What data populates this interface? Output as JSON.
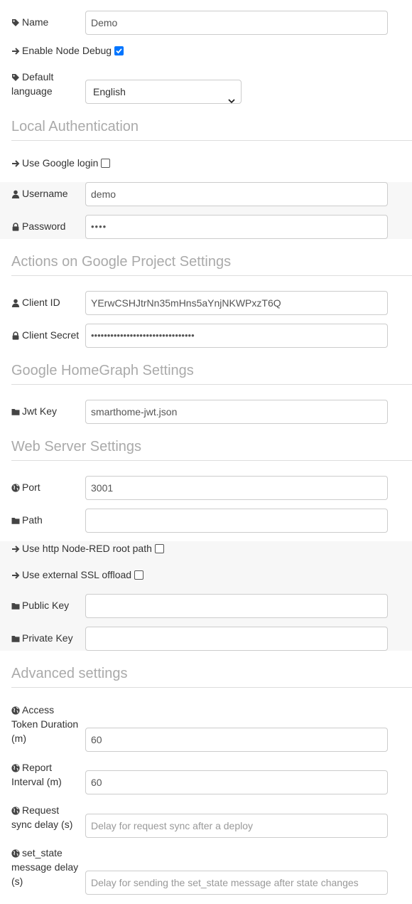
{
  "general": {
    "name_label": "Name",
    "name_value": "Demo",
    "debug_label": "Enable Node Debug",
    "debug_checked": true,
    "language_label_1": "Default",
    "language_label_2": "language",
    "language_value": "English"
  },
  "local_auth": {
    "title": "Local Authentication",
    "google_login_label": "Use Google login",
    "username_label": "Username",
    "username_value": "demo",
    "password_label": "Password",
    "password_mask": "••••"
  },
  "actions_google": {
    "title": "Actions on Google Project Settings",
    "client_id_label": "Client ID",
    "client_id_value": "YErwCSHJtrNn35mHns5aYnjNKWPxzT6Q",
    "client_secret_label": "Client Secret",
    "client_secret_mask": "••••••••••••••••••••••••••••••••"
  },
  "homegraph": {
    "title": "Google HomeGraph Settings",
    "jwt_label": "Jwt Key",
    "jwt_value": "smarthome-jwt.json"
  },
  "web_server": {
    "title": "Web Server Settings",
    "port_label": "Port",
    "port_value": "3001",
    "path_label": "Path",
    "path_value": "",
    "http_root_label": "Use http Node-RED root path",
    "ssl_offload_label": "Use external SSL offload",
    "public_key_label": "Public Key",
    "public_key_value": "",
    "private_key_label": "Private Key",
    "private_key_value": ""
  },
  "advanced": {
    "title": "Advanced settings",
    "token_label_1": "Access",
    "token_label_2": "Token Duration",
    "token_label_3": "(m)",
    "token_value": "60",
    "report_label_1": "Report",
    "report_label_2": "Interval (m)",
    "report_value": "60",
    "sync_label_1": "Request",
    "sync_label_2": "sync delay (s)",
    "sync_placeholder": "Delay for request sync after a deploy",
    "setstate_label_1": "set_state",
    "setstate_label_2": "message delay",
    "setstate_label_3": "(s)",
    "setstate_placeholder": "Delay for sending the set_state message after state changes"
  },
  "icons": {
    "tag": "tag-icon",
    "arrow": "arrow-right-icon",
    "user": "user-icon",
    "lock": "lock-icon",
    "folder": "folder-icon",
    "globe": "globe-icon"
  },
  "colors": {
    "checkbox_checked": "#0075ff",
    "section_title": "#aaaaaa",
    "row_shade": "#f7f7f7"
  }
}
